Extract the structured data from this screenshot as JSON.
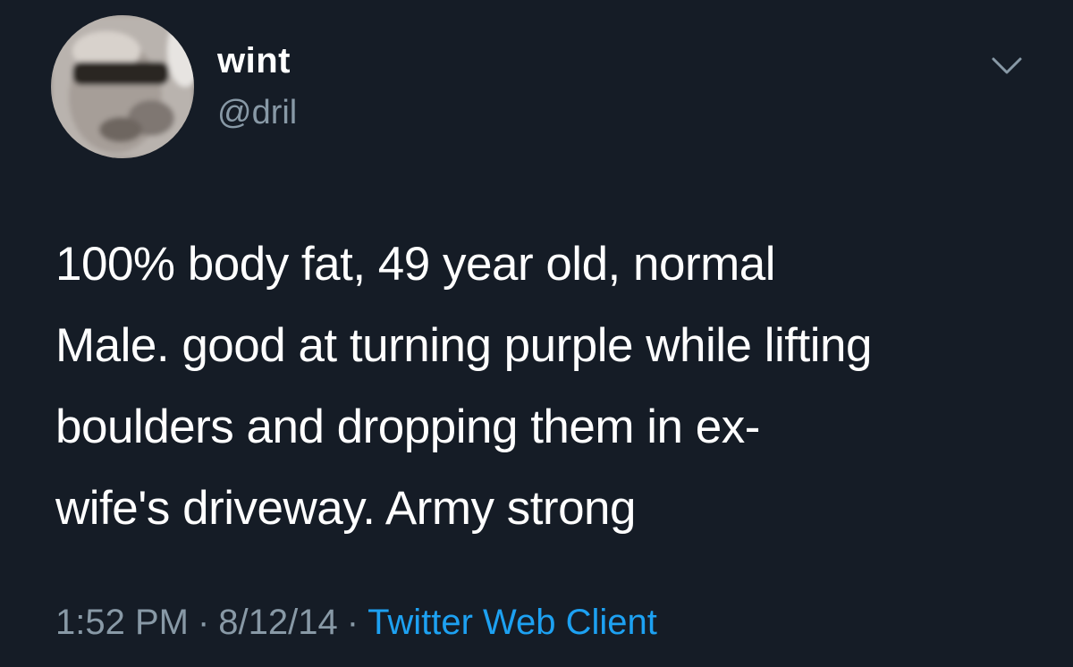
{
  "tweet": {
    "author": {
      "display_name": "wint",
      "handle": "@dril",
      "avatar": "avatar-photo"
    },
    "menu_icon": "chevron-down-icon",
    "text": "100% body fat, 49 year old, normal\nMale. good at turning purple while lifting\nboulders and dropping them in ex-\nwife's driveway. Army strong",
    "time": "1:52 PM",
    "date": "8/12/14",
    "separator": "·",
    "client": "Twitter Web Client"
  },
  "colors": {
    "background": "#151c26",
    "text": "#ffffff",
    "secondary_text": "#8899a6",
    "link": "#1da1f2"
  }
}
